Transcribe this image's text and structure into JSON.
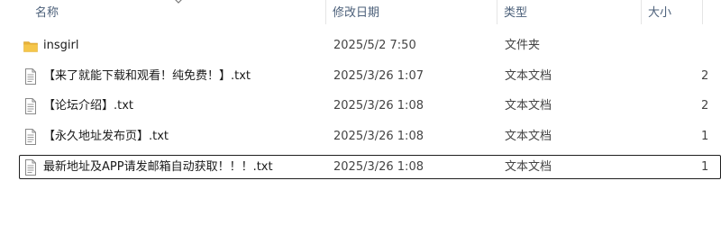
{
  "columns": {
    "name": "名称",
    "modified": "修改日期",
    "type": "类型",
    "size": "大小"
  },
  "files": [
    {
      "name": "insgirl",
      "modified": "2025/5/2 7:50",
      "type": "文件夹",
      "size": "",
      "icon": "folder-icon"
    },
    {
      "name": "【来了就能下载和观看！纯免费！】.txt",
      "modified": "2025/3/26 1:07",
      "type": "文本文档",
      "size": "2",
      "icon": "text-file-icon"
    },
    {
      "name": "【论坛介绍】.txt",
      "modified": "2025/3/26 1:08",
      "type": "文本文档",
      "size": "2",
      "icon": "text-file-icon"
    },
    {
      "name": "【永久地址发布页】.txt",
      "modified": "2025/3/26 1:08",
      "type": "文本文档",
      "size": "1",
      "icon": "text-file-icon"
    },
    {
      "name": "最新地址及APP请发邮箱自动获取！！！.txt",
      "modified": "2025/3/26 1:08",
      "type": "文本文档",
      "size": "1",
      "icon": "text-file-icon"
    }
  ],
  "colors": {
    "header_text": "#4c607a",
    "folder": "#f5c64a",
    "focus_border": "#1f1f1f"
  }
}
